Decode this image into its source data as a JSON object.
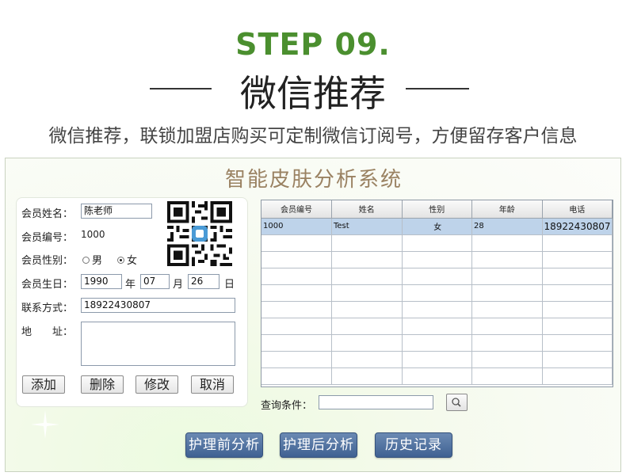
{
  "header": {
    "step": "STEP  09.",
    "title": "微信推荐",
    "description": "微信推荐，联锁加盟店购买可定制微信订阅号，方便留存客户信息"
  },
  "app": {
    "title": "智能皮肤分析系统",
    "form": {
      "name_label": "会员姓名：",
      "name_value": "陈老师",
      "id_label": "会员编号：",
      "id_value": "1000",
      "gender_label": "会员性别：",
      "gender_male": "男",
      "gender_female": "女",
      "gender_selected": "女",
      "birthday_label": "会员生日：",
      "birth_year": "1990",
      "year_unit": "年",
      "birth_month": "07",
      "month_unit": "月",
      "birth_day": "26",
      "day_unit": "日",
      "contact_label": "联系方式：",
      "contact_value": "18922430807",
      "address_label": "地　　址：",
      "address_value": "",
      "buttons": {
        "add": "添加",
        "delete": "删除",
        "edit": "修改",
        "cancel": "取消"
      }
    },
    "table": {
      "columns": [
        "会员编号",
        "姓名",
        "性别",
        "年龄",
        "电话"
      ],
      "rows": [
        [
          "1000",
          "Test",
          "女",
          "28",
          "18922430807"
        ]
      ]
    },
    "query": {
      "label": "查询条件：",
      "value": ""
    },
    "actions": {
      "before_analysis": "护理前分析",
      "after_analysis": "护理后分析",
      "history": "历史记录"
    },
    "colors": {
      "step_green": "#4b8f2f",
      "title_brown": "#9a8262",
      "button_blue": "#4f6f9f",
      "selected_row": "#bed3ea"
    }
  }
}
